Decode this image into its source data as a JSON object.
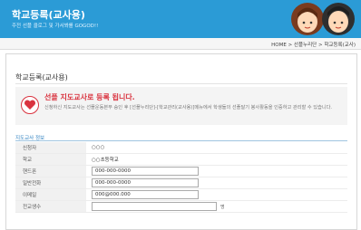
{
  "header": {
    "title": "학교등록(교사용)",
    "subtitle": "주전 선플 클로그 및 가서봐를 GOGOD!!"
  },
  "breadcrumb": "HOME > 선플누리단 > 학교등록(교사)",
  "panel_title": "학교등록(교사용)",
  "notice": {
    "title": "선플 지도교사로 등록 됩니다.",
    "body": "신청하신 지도교사는 선플운동본부 승인 후 [선플누리단]-[학교관리(교사용)]메뉴에서 학생들의 선플달기 봉사활동을 인증하고 관리할 수 있습니다."
  },
  "section_label": "지도교사 정보",
  "form": {
    "applicant": {
      "label": "신청자",
      "value": "○○○"
    },
    "school": {
      "label": "학교",
      "value": "○○초등학교"
    },
    "mobile": {
      "label": "핸드폰",
      "value": "000-000-0000"
    },
    "phone": {
      "label": "일반전화",
      "value": "000-000-0000"
    },
    "email": {
      "label": "이메일",
      "value": "000@000.000"
    },
    "students": {
      "label": "전교생수",
      "value": "",
      "unit": "명"
    }
  },
  "colors": {
    "header": "#2b9bd6",
    "notice_title": "#d9333f",
    "heart": "#d9333f"
  }
}
